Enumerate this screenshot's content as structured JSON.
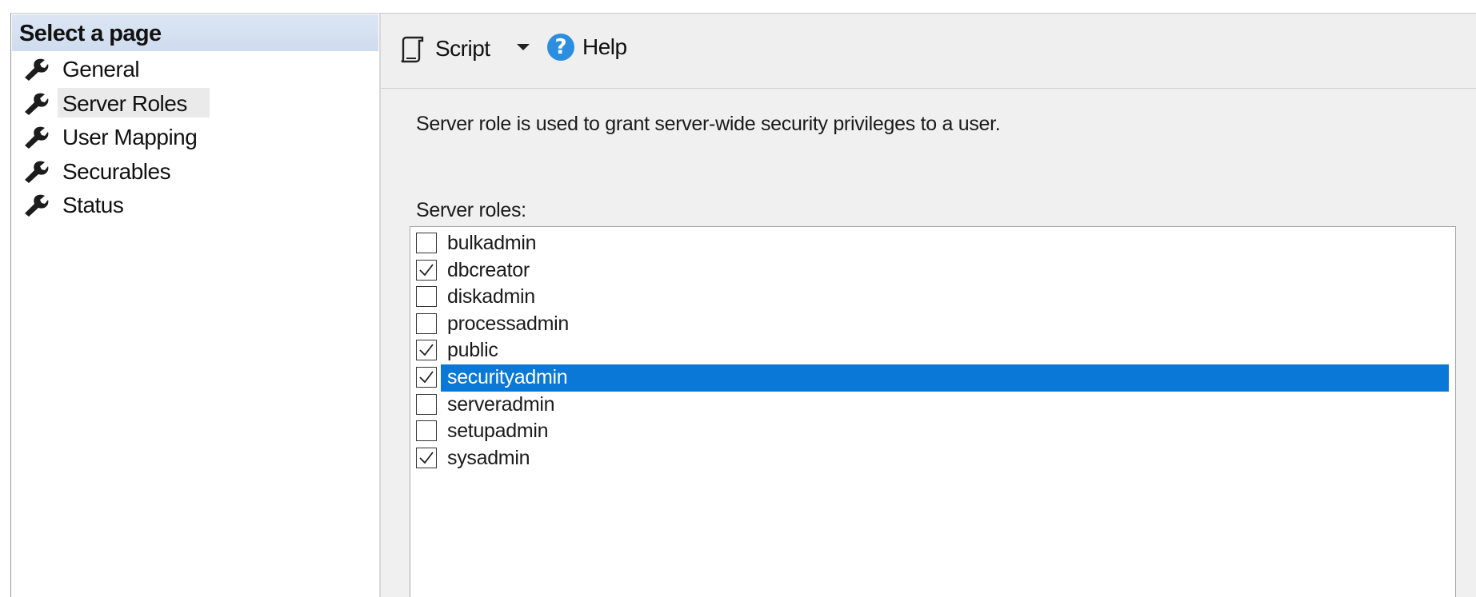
{
  "sidebar": {
    "header": "Select a page",
    "items": [
      {
        "label": "General",
        "icon": "wrench-icon"
      },
      {
        "label": "Server Roles",
        "icon": "wrench-icon",
        "active": true
      },
      {
        "label": "User Mapping",
        "icon": "wrench-icon"
      },
      {
        "label": "Securables",
        "icon": "wrench-icon"
      },
      {
        "label": "Status",
        "icon": "wrench-icon"
      }
    ]
  },
  "toolbar": {
    "script_label": "Script",
    "script_icon": "script-icon",
    "dropdown_icon": "chevron-down-icon",
    "help_label": "Help",
    "help_icon": "help-icon",
    "help_glyph": "?"
  },
  "main": {
    "description": "Server role is used to grant server-wide security privileges to a user.",
    "roles_label": "Server roles:",
    "roles": [
      {
        "name": "bulkadmin",
        "checked": false
      },
      {
        "name": "dbcreator",
        "checked": true
      },
      {
        "name": "diskadmin",
        "checked": false
      },
      {
        "name": "processadmin",
        "checked": false
      },
      {
        "name": "public",
        "checked": true
      },
      {
        "name": "securityadmin",
        "checked": true,
        "selected": true
      },
      {
        "name": "serveradmin",
        "checked": false
      },
      {
        "name": "setupadmin",
        "checked": false
      },
      {
        "name": "sysadmin",
        "checked": true
      }
    ]
  },
  "colors": {
    "selection": "#0a78d7",
    "help_icon": "#2b8ee0",
    "sidebar_header": "#d6e1f1"
  }
}
